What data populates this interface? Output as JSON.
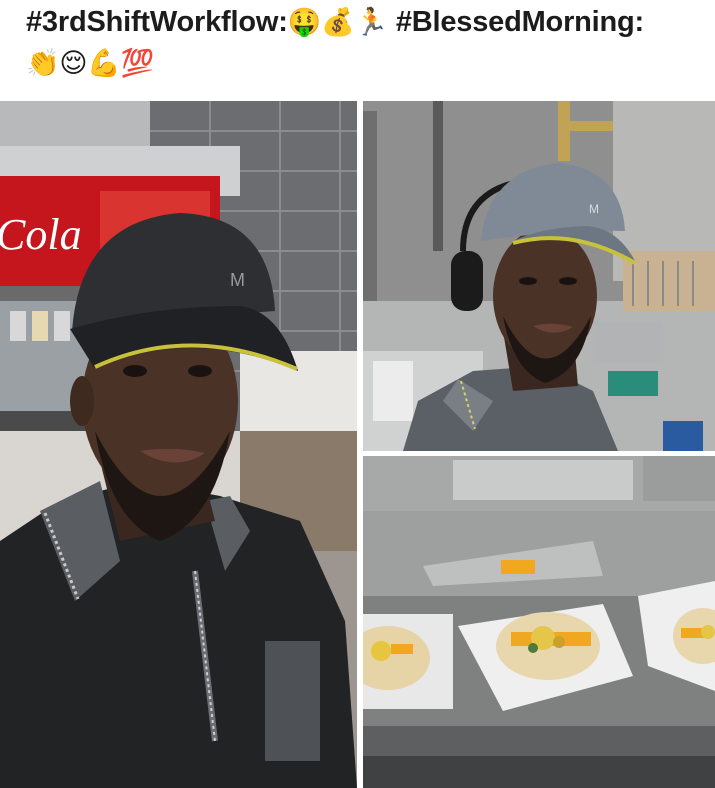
{
  "post": {
    "text_line1": "#3rdShiftWorkflow:🤑💰🏃 #BlessedMorning:",
    "text_line2": "👏😌💪💯",
    "hashtag_one": "#3rdShiftWorkflow:",
    "emojis_one": "🤑💰🏃",
    "hashtag_two": "#BlessedMorning:",
    "emojis_two": "👏😌💪💯"
  },
  "photos": {
    "left": {
      "sign_text": "Cola",
      "cap_logo": "M"
    },
    "top_right": {
      "cap_logo": "M"
    },
    "bottom_right": {}
  },
  "colors": {
    "cap_dark": "#2d2f32",
    "cap_grey": "#7f8a96",
    "cap_trim": "#c8c23a",
    "shirt_dark": "#222325",
    "coke_red": "#c4161c",
    "steel": "#9a9a9a"
  }
}
